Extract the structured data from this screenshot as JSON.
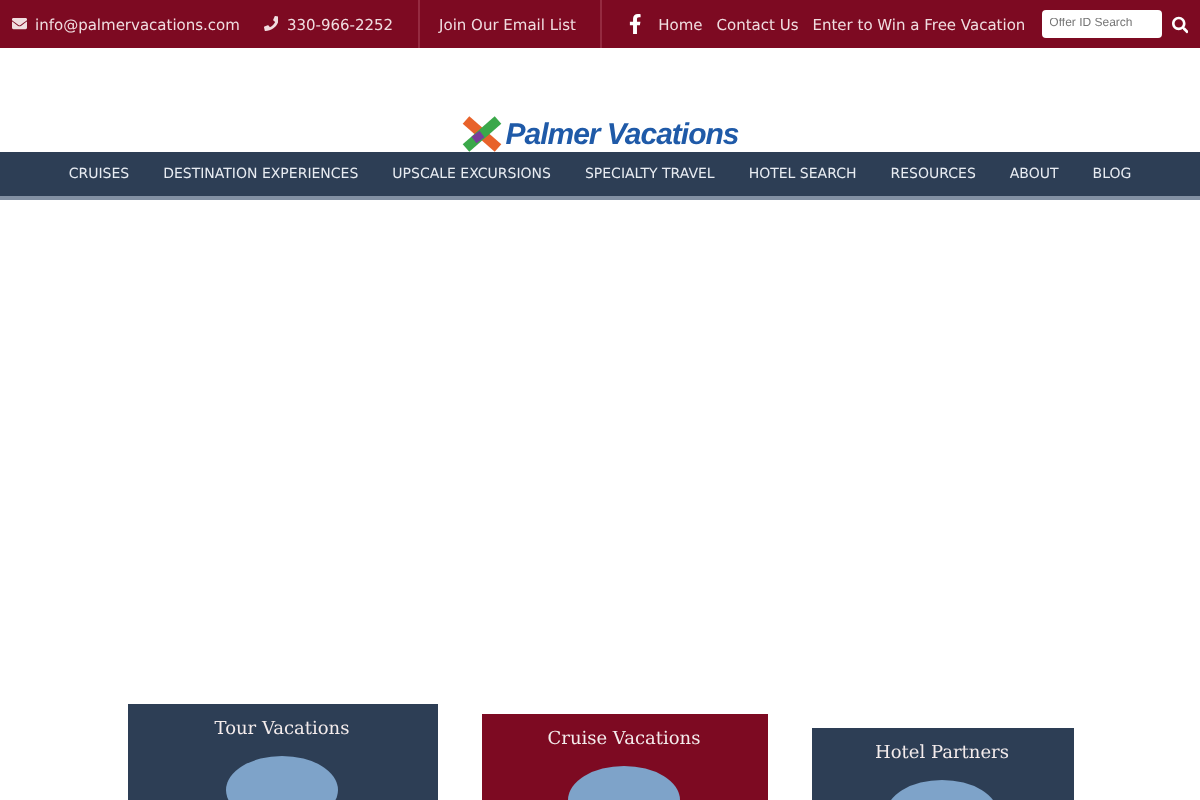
{
  "top_bar": {
    "email": "info@palmervacations.com",
    "phone": "330-966-2252",
    "newsletter": "Join Our Email List",
    "links": [
      "Home",
      "Contact Us",
      "Enter to Win a Free Vacation"
    ],
    "search": {
      "placeholder": "Offer ID Search"
    }
  },
  "logo": {
    "text": "Palmer Vacations"
  },
  "nav": [
    "CRUISES",
    "DESTINATION EXPERIENCES",
    "UPSCALE EXCURSIONS",
    "SPECIALTY TRAVEL",
    "HOTEL SEARCH",
    "RESOURCES",
    "ABOUT",
    "BLOG"
  ],
  "cards": [
    {
      "title": "Tour Vacations",
      "color": "#2d3e55"
    },
    {
      "title": "Cruise Vacations",
      "color": "#7d0a22"
    },
    {
      "title": "Hotel Partners",
      "color": "#2d3e55"
    }
  ]
}
